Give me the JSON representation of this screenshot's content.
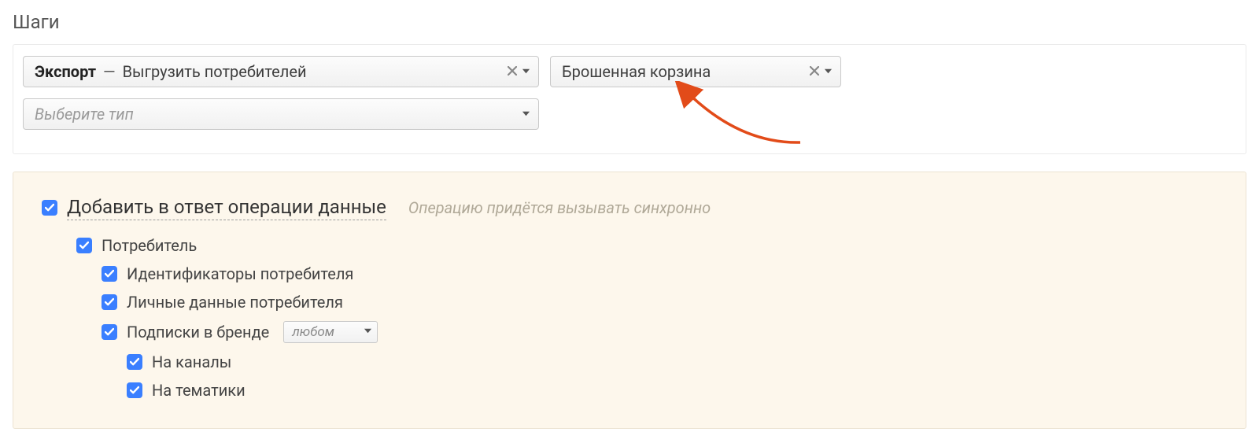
{
  "sectionTitle": "Шаги",
  "steps": {
    "step1": {
      "prefix": "Экспорт",
      "sep": "—",
      "text": "Выгрузить потребителей"
    },
    "step2": {
      "text": "Брошенная корзина"
    },
    "typeSelector": {
      "placeholder": "Выберите тип"
    }
  },
  "options": {
    "main": {
      "label": "Добавить в ответ операции данные",
      "hint": "Операцию придётся вызывать синхронно"
    },
    "consumer": {
      "label": "Потребитель"
    },
    "identifiers": {
      "label": "Идентификаторы потребителя"
    },
    "personal": {
      "label": "Личные данные потребителя"
    },
    "subscriptions": {
      "label": "Подписки в бренде",
      "brandPlaceholder": "любом"
    },
    "channels": {
      "label": "На каналы"
    },
    "topics": {
      "label": "На тематики"
    }
  }
}
